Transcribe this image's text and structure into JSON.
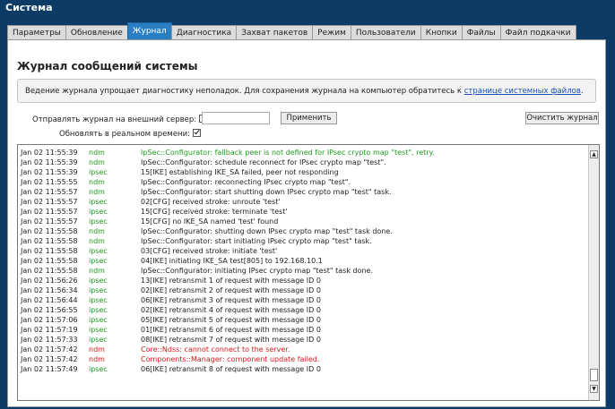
{
  "app_title": "Система",
  "tabs": [
    {
      "label": "Параметры",
      "active": false
    },
    {
      "label": "Обновление",
      "active": false
    },
    {
      "label": "Журнал",
      "active": true
    },
    {
      "label": "Диагностика",
      "active": false
    },
    {
      "label": "Захват пакетов",
      "active": false
    },
    {
      "label": "Режим",
      "active": false
    },
    {
      "label": "Пользователи",
      "active": false
    },
    {
      "label": "Кнопки",
      "active": false
    },
    {
      "label": "Файлы",
      "active": false
    },
    {
      "label": "Файл подкачки",
      "active": false
    }
  ],
  "page_title": "Журнал сообщений системы",
  "info": {
    "text": "Ведение журнала упрощает диагностику неполадок. Для сохранения журнала на компьютер обратитесь к ",
    "link": "странице системных файлов",
    "end": "."
  },
  "controls": {
    "send_label": "Отправлять журнал на внешний сервер:",
    "send_checked": false,
    "server_value": "",
    "apply_label": "Применить",
    "clear_label": "Очистить журнал",
    "realtime_label": "Обновлять в реальном времени:",
    "realtime_checked": true
  },
  "colors": {
    "ndm": "#1f9a1f",
    "ipsec": "#1f9a1f",
    "error": "#d41a1a",
    "text": "#222222",
    "active_tab": "#2a7fc4",
    "header_bg": "#0c3c66"
  },
  "log": [
    {
      "date": "Jan 02 11:55:39",
      "src": "ndm",
      "msg": "IpSec::Configurator: fallback peer is not defined for IPsec crypto map \"test\", retry.",
      "level": "info"
    },
    {
      "date": "Jan 02 11:55:39",
      "src": "ndm",
      "msg": "IpSec::Configurator: schedule reconnect for IPsec crypto map \"test\".",
      "level": "normal"
    },
    {
      "date": "Jan 02 11:55:39",
      "src": "ipsec",
      "msg": "15[IKE] establishing IKE_SA failed, peer not responding",
      "level": "normal"
    },
    {
      "date": "Jan 02 11:55:55",
      "src": "ndm",
      "msg": "IpSec::Configurator: reconnecting IPsec crypto map \"test\".",
      "level": "normal"
    },
    {
      "date": "Jan 02 11:55:57",
      "src": "ndm",
      "msg": "IpSec::Configurator: start shutting down IPsec crypto map \"test\" task.",
      "level": "normal"
    },
    {
      "date": "Jan 02 11:55:57",
      "src": "ipsec",
      "msg": "02[CFG] received stroke: unroute 'test'",
      "level": "normal"
    },
    {
      "date": "Jan 02 11:55:57",
      "src": "ipsec",
      "msg": "15[CFG] received stroke: terminate 'test'",
      "level": "normal"
    },
    {
      "date": "Jan 02 11:55:57",
      "src": "ipsec",
      "msg": "15[CFG] no IKE_SA named 'test' found",
      "level": "normal"
    },
    {
      "date": "Jan 02 11:55:58",
      "src": "ndm",
      "msg": "IpSec::Configurator: shutting down IPsec crypto map \"test\" task done.",
      "level": "normal"
    },
    {
      "date": "Jan 02 11:55:58",
      "src": "ndm",
      "msg": "IpSec::Configurator: start initiating IPsec crypto map \"test\" task.",
      "level": "normal"
    },
    {
      "date": "Jan 02 11:55:58",
      "src": "ipsec",
      "msg": "03[CFG] received stroke: initiate 'test'",
      "level": "normal"
    },
    {
      "date": "Jan 02 11:55:58",
      "src": "ipsec",
      "msg": "04[IKE] initiating IKE_SA test[805] to 192.168.10.1",
      "level": "normal"
    },
    {
      "date": "Jan 02 11:55:58",
      "src": "ndm",
      "msg": "IpSec::Configurator: initiating IPsec crypto map \"test\" task done.",
      "level": "normal"
    },
    {
      "date": "Jan 02 11:56:26",
      "src": "ipsec",
      "msg": "13[IKE] retransmit 1 of request with message ID 0",
      "level": "normal"
    },
    {
      "date": "Jan 02 11:56:34",
      "src": "ipsec",
      "msg": "02[IKE] retransmit 2 of request with message ID 0",
      "level": "normal"
    },
    {
      "date": "Jan 02 11:56:44",
      "src": "ipsec",
      "msg": "06[IKE] retransmit 3 of request with message ID 0",
      "level": "normal"
    },
    {
      "date": "Jan 02 11:56:55",
      "src": "ipsec",
      "msg": "02[IKE] retransmit 4 of request with message ID 0",
      "level": "normal"
    },
    {
      "date": "Jan 02 11:57:06",
      "src": "ipsec",
      "msg": "05[IKE] retransmit 5 of request with message ID 0",
      "level": "normal"
    },
    {
      "date": "Jan 02 11:57:19",
      "src": "ipsec",
      "msg": "01[IKE] retransmit 6 of request with message ID 0",
      "level": "normal"
    },
    {
      "date": "Jan 02 11:57:33",
      "src": "ipsec",
      "msg": "08[IKE] retransmit 7 of request with message ID 0",
      "level": "normal"
    },
    {
      "date": "Jan 02 11:57:42",
      "src": "ndm",
      "msg": "Core::Ndss: cannot connect to the server.",
      "level": "error"
    },
    {
      "date": "Jan 02 11:57:42",
      "src": "ndm",
      "msg": "Components::Manager: component update failed.",
      "level": "error"
    },
    {
      "date": "Jan 02 11:57:49",
      "src": "ipsec",
      "msg": "06[IKE] retransmit 8 of request with message ID 0",
      "level": "normal"
    }
  ]
}
